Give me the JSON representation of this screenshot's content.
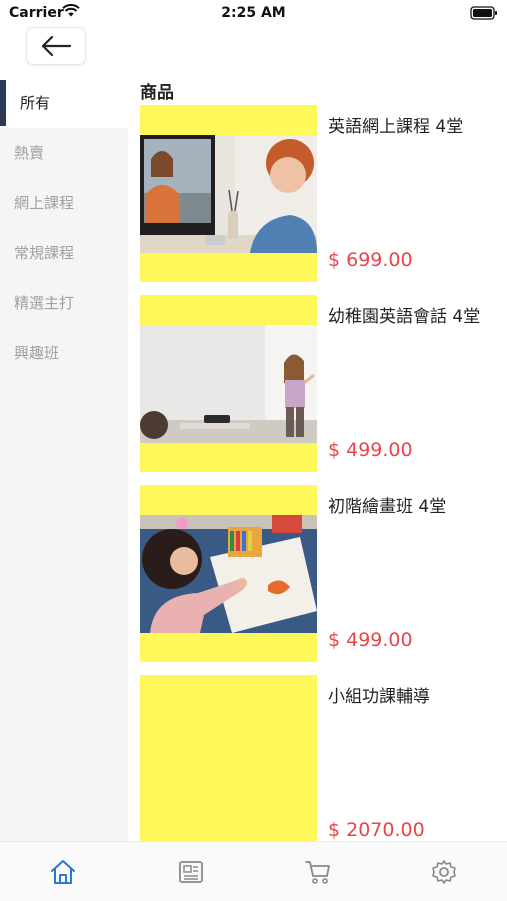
{
  "status_bar": {
    "carrier": "Carrier",
    "time": "2:25 AM"
  },
  "header": {
    "back_icon": "arrow-left-icon"
  },
  "sidebar": {
    "items": [
      {
        "label": "所有",
        "active": true
      },
      {
        "label": "熱賣",
        "active": false
      },
      {
        "label": "網上課程",
        "active": false
      },
      {
        "label": "常規課程",
        "active": false
      },
      {
        "label": "精選主打",
        "active": false
      },
      {
        "label": "興趣班",
        "active": false
      }
    ]
  },
  "main": {
    "section_title": "商品",
    "products": [
      {
        "name": "英語網上課程 4堂",
        "price": "$ 699.00"
      },
      {
        "name": "幼稚園英語會話 4堂",
        "price": "$ 499.00"
      },
      {
        "name": "初階繪畫班 4堂",
        "price": "$ 499.00"
      },
      {
        "name": "小組功課輔導",
        "price": "$ 2070.00"
      }
    ]
  },
  "tab_bar": {
    "tabs": [
      {
        "icon": "home-icon",
        "active": true
      },
      {
        "icon": "news-icon",
        "active": false
      },
      {
        "icon": "cart-icon",
        "active": false
      },
      {
        "icon": "settings-icon",
        "active": false
      }
    ]
  },
  "colors": {
    "accent": "#2a78d6",
    "price": "#e8454a",
    "image_placeholder": "#fff85a",
    "sidebar_active_marker": "#2a3a55"
  }
}
